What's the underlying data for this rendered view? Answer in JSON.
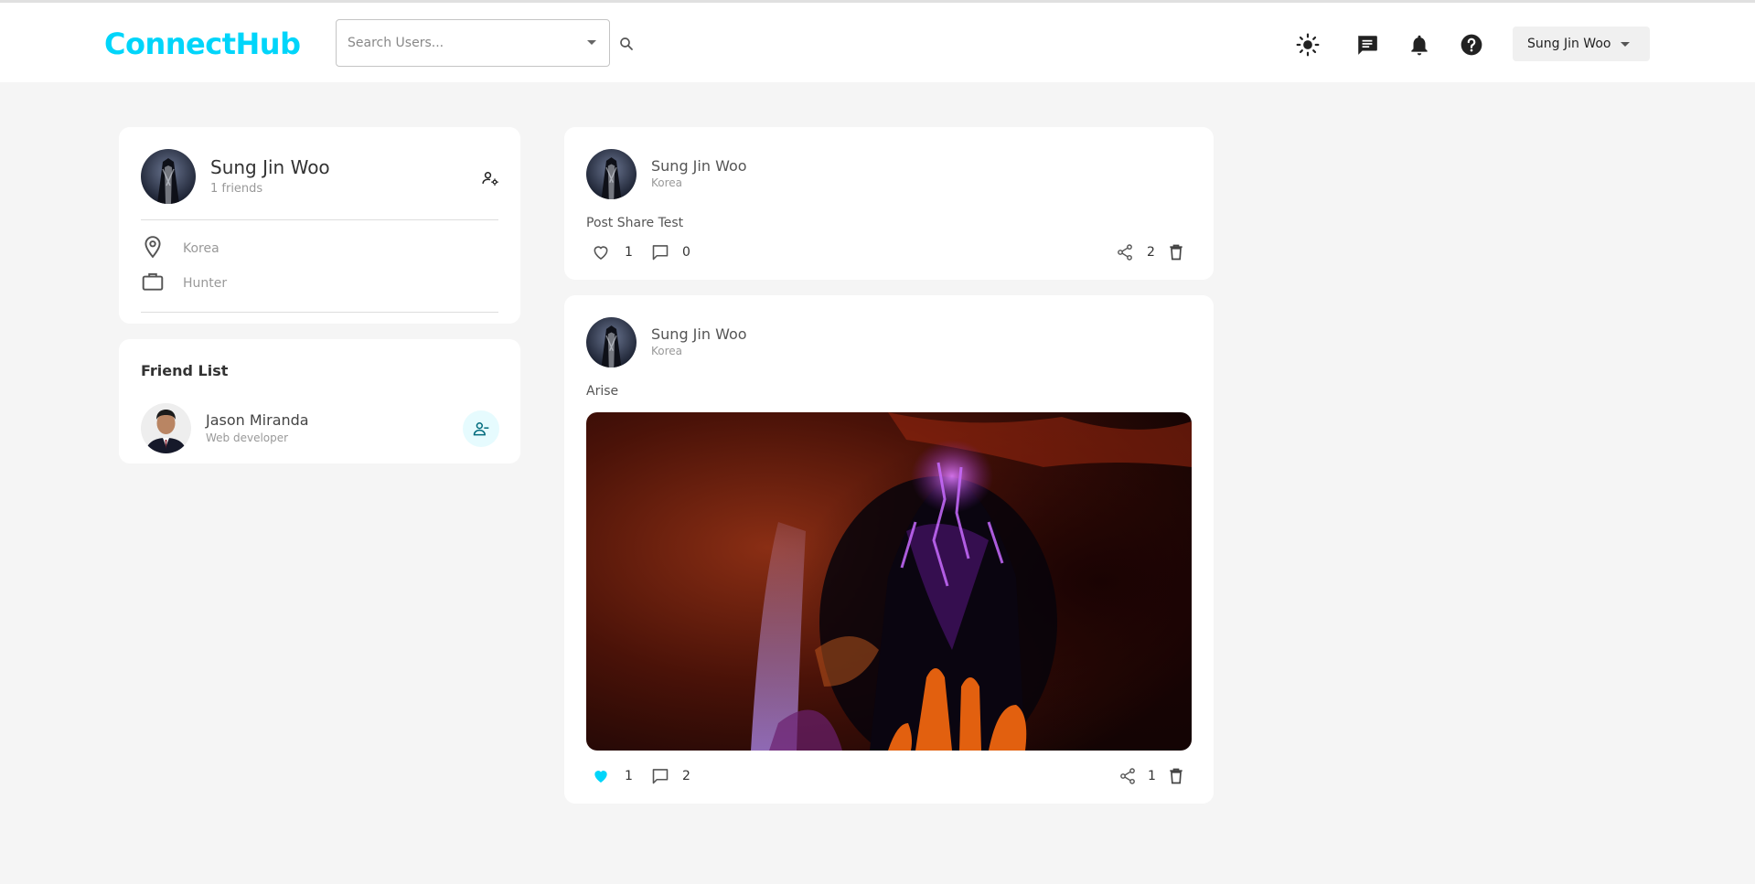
{
  "app": {
    "logo": "ConnectHub"
  },
  "search": {
    "placeholder": "Search Users..."
  },
  "header": {
    "icons": [
      "sun-icon",
      "message-icon",
      "bell-icon",
      "help-icon"
    ],
    "user_menu_label": "Sung Jin Woo"
  },
  "colors": {
    "accent": "#00d5fa",
    "background": "#f5f5f5",
    "card": "#ffffff"
  },
  "profile": {
    "name": "Sung Jin Woo",
    "friends": "1 friends",
    "location": "Korea",
    "occupation": "Hunter"
  },
  "friend_list": {
    "title": "Friend List",
    "friends": [
      {
        "name": "Jason Miranda",
        "subtitle": "Web developer"
      }
    ]
  },
  "posts": [
    {
      "author": "Sung Jin Woo",
      "location": "Korea",
      "text": "Post Share Test",
      "likes": "1",
      "liked": false,
      "comments": "0",
      "shares": "2"
    },
    {
      "author": "Sung Jin Woo",
      "location": "Korea",
      "text": "Arise",
      "has_image": true,
      "likes": "1",
      "liked": true,
      "comments": "2",
      "shares": "1"
    }
  ]
}
